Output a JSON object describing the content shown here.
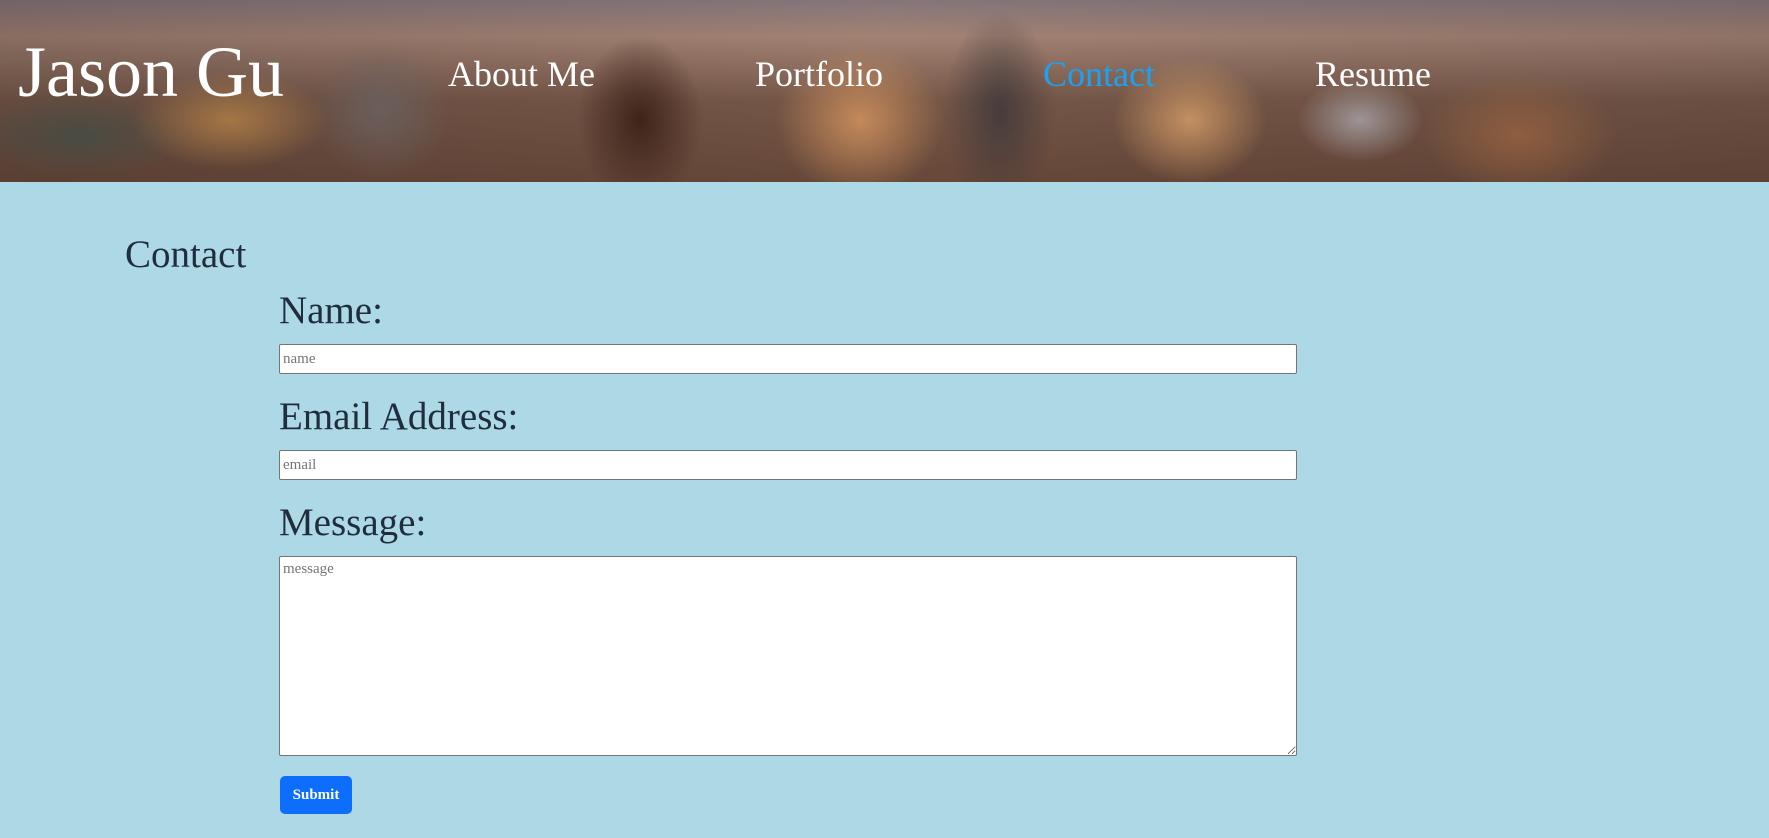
{
  "header": {
    "brand": "Jason Gu",
    "nav": [
      {
        "label": "About Me",
        "active": false
      },
      {
        "label": "Portfolio",
        "active": false
      },
      {
        "label": "Contact",
        "active": true
      },
      {
        "label": "Resume",
        "active": false
      }
    ],
    "active_color": "#1da1f2"
  },
  "main": {
    "title": "Contact",
    "form": {
      "name_label": "Name:",
      "name_placeholder": "name",
      "email_label": "Email Address:",
      "email_placeholder": "email",
      "message_label": "Message:",
      "message_placeholder": "message",
      "submit_label": "Submit"
    }
  },
  "colors": {
    "page_background": "#add8e6",
    "button": "#0d6efd",
    "text": "#1f2d3d"
  }
}
